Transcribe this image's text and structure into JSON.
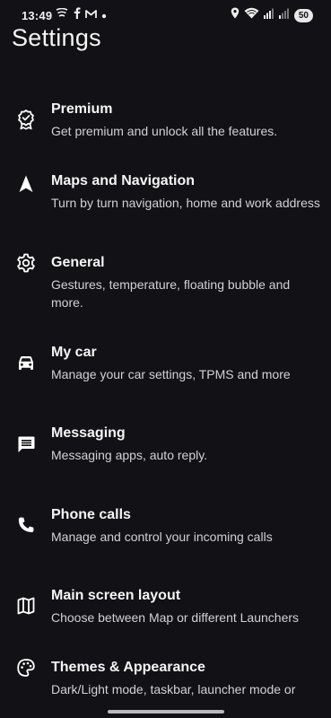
{
  "status_bar": {
    "time": "13:49",
    "battery": "50",
    "icons": [
      "cast-icon",
      "facebook-icon",
      "gmail-icon",
      "notification-dot-icon",
      "location-icon",
      "wifi-icon",
      "signal-icon",
      "signal-weak-icon"
    ]
  },
  "page": {
    "title": "Settings"
  },
  "items": [
    {
      "icon": "premium-badge-icon",
      "title": "Premium",
      "description": "Get premium and unlock all the features."
    },
    {
      "icon": "navigation-arrow-icon",
      "title": "Maps and Navigation",
      "description": "Turn by turn navigation, home and work address"
    },
    {
      "icon": "gear-icon",
      "title": "General",
      "description": "Gestures, temperature, floating bubble and more."
    },
    {
      "icon": "car-icon",
      "title": "My car",
      "description": "Manage your car settings, TPMS and more"
    },
    {
      "icon": "message-icon",
      "title": "Messaging",
      "description": "Messaging apps, auto reply."
    },
    {
      "icon": "phone-icon",
      "title": "Phone calls",
      "description": "Manage and control your incoming calls"
    },
    {
      "icon": "map-icon",
      "title": "Main screen layout",
      "description": "Choose between Map or different Launchers"
    },
    {
      "icon": "palette-icon",
      "title": "Themes & Appearance",
      "description": "Dark/Light mode, taskbar, launcher mode or"
    }
  ],
  "colors": {
    "background": "#121116",
    "title_text": "#f5f5f5",
    "description_text": "#d2d2d6"
  }
}
